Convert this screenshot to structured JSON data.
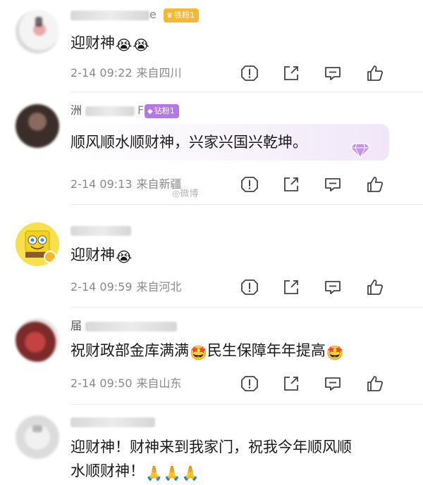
{
  "comments": [
    {
      "username_visible": "e",
      "fan_badge": "铁粉1",
      "text": "迎财神",
      "emojis": [
        "😭",
        "😭"
      ],
      "time": "2-14 09:22",
      "location": "来自四川"
    },
    {
      "username_visible": "F",
      "fan_badge": "钻粉1",
      "text": "顺风顺水顺财神，兴家兴国兴乾坤。",
      "emojis": [],
      "time": "2-14 09:13",
      "location": "来自新疆",
      "watermark": "微博"
    },
    {
      "username_visible": "",
      "fan_badge": "",
      "text": "迎财神",
      "emojis": [
        "😭"
      ],
      "time": "2-14 09:59",
      "location": "来自河北"
    },
    {
      "username_visible": "",
      "fan_badge": "",
      "text_part1": "祝财政部金库满满",
      "text_part2": "民生保障年年提高",
      "emojis": [
        "🤩",
        "🤩"
      ],
      "time": "2-14 09:50",
      "location": "来自山东"
    },
    {
      "username_visible": "",
      "fan_badge": "",
      "text_line1": "迎财神！财神来到我家门，祝我今年顺风顺",
      "text_line2": "水顺财神！",
      "emojis": [
        "🙏",
        "🙏",
        "🙏"
      ]
    }
  ],
  "action_icons": [
    "report-icon",
    "share-icon",
    "reply-icon",
    "like-icon"
  ],
  "colors": {
    "iron_fan_badge": "#f5b931",
    "diamond_fan_badge": "#b577e6",
    "meta_text": "#8a8a8a",
    "body_text": "#1a1a1a"
  }
}
